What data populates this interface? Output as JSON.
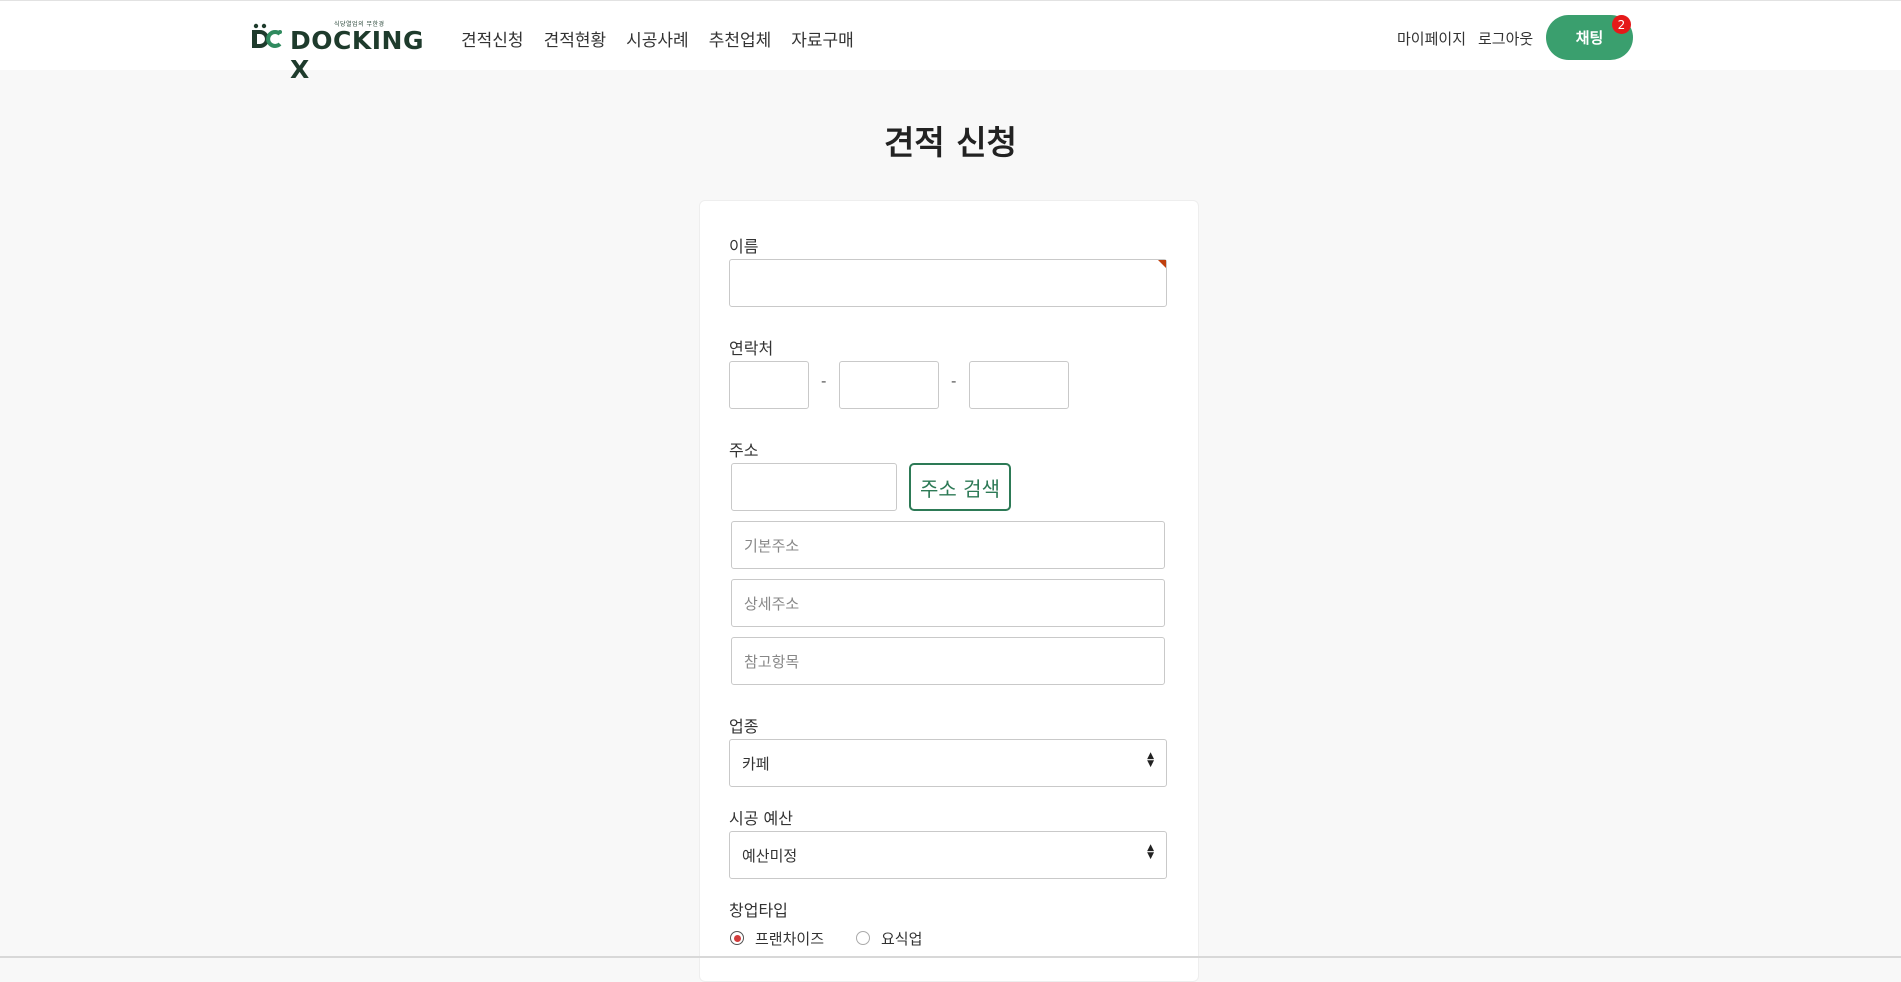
{
  "header": {
    "logo_tagline": "식당열업의 무한경",
    "logo_text": "DOCKING X",
    "nav": [
      "견적신청",
      "견적현황",
      "시공사례",
      "추천업체",
      "자료구매"
    ],
    "mypage": "마이페이지",
    "logout": "로그아웃",
    "chat_label": "채팅",
    "chat_badge": "2"
  },
  "page": {
    "title": "견적 신청"
  },
  "form": {
    "name_label": "이름",
    "name_value": "",
    "phone_label": "연락처",
    "phone_sep": "-",
    "address_label": "주소",
    "address_search_button": "주소 검색",
    "base_address_placeholder": "기본주소",
    "detail_address_placeholder": "상세주소",
    "reference_placeholder": "참고항목",
    "business_label": "업종",
    "business_value": "카페",
    "budget_label": "시공 예산",
    "budget_value": "예산미정",
    "startup_type_label": "창업타입",
    "startup_options": [
      "프랜차이즈",
      "요식업"
    ],
    "startup_selected": "프랜차이즈"
  },
  "colors": {
    "brand_green": "#3a9f6e",
    "logo_green": "#1e3b2c",
    "badge_red": "#e51919",
    "radio_red": "#d23c3c"
  }
}
